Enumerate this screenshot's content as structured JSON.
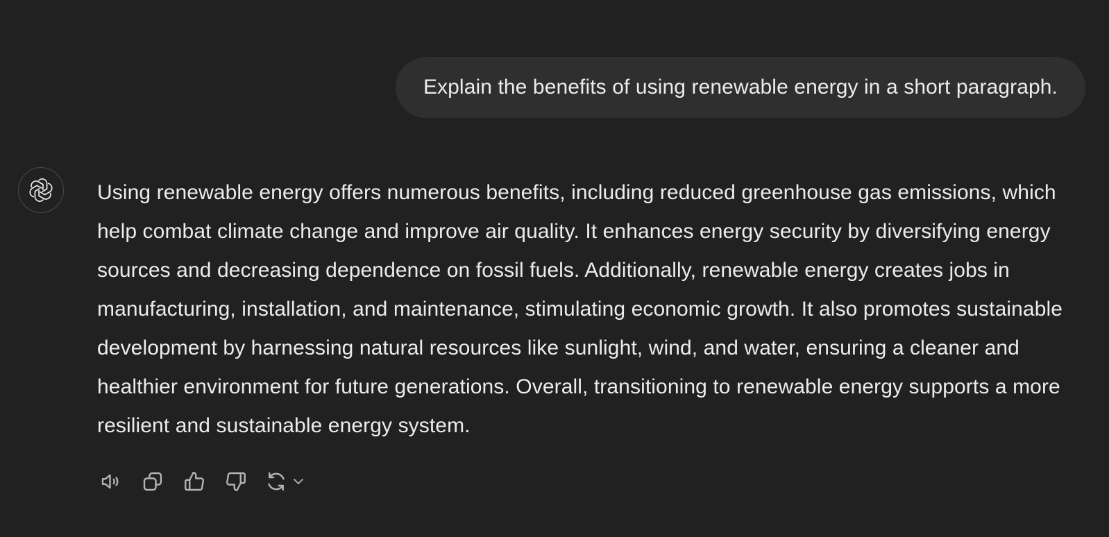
{
  "conversation": {
    "user_message": "Explain the benefits of using renewable energy in a short paragraph.",
    "assistant_message": "Using renewable energy offers numerous benefits, including reduced greenhouse gas emissions, which help combat climate change and improve air quality. It enhances energy security by diversifying energy sources and decreasing dependence on fossil fuels. Additionally, renewable energy creates jobs in manufacturing, installation, and maintenance, stimulating economic growth. It also promotes sustainable development by harnessing natural resources like sunlight, wind, and water, ensuring a cleaner and healthier environment for future generations. Overall, transitioning to renewable energy supports a more resilient and sustainable energy system."
  },
  "actions": {
    "icons": [
      "speaker-icon",
      "copy-icon",
      "thumbs-up-icon",
      "thumbs-down-icon",
      "regenerate-icon",
      "chevron-down-icon"
    ]
  },
  "colors": {
    "background": "#212121",
    "user_bubble": "#2f2f2f",
    "text": "#ececec",
    "icon": "#b4b4b4"
  }
}
